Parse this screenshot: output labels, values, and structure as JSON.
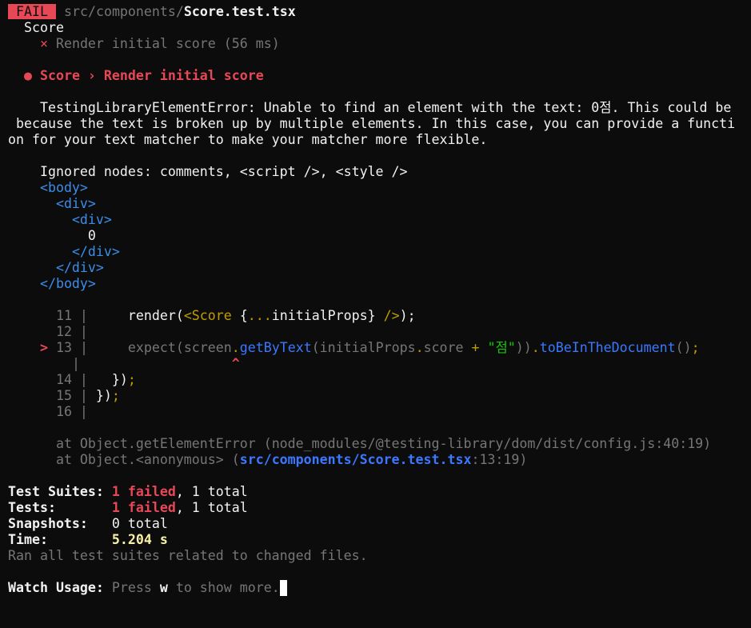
{
  "header": {
    "badge": "FAIL",
    "path_dir": "src/components/",
    "path_file": "Score.test.tsx"
  },
  "suite": {
    "name": "Score",
    "cross": "×",
    "test_name": "Render initial score (56 ms)"
  },
  "failure": {
    "bullet": "●",
    "title": "Score › Render initial score",
    "error_lines": [
      "TestingLibraryElementError: Unable to find an element with the text: 0점. This could be",
      " because the text is broken up by multiple elements. In this case, you can provide a functi",
      "on for your text matcher to make your matcher more flexible."
    ],
    "ignored": "Ignored nodes: comments, <script />, <style />",
    "dom": {
      "body_open": "<body>",
      "div_open": "<div>",
      "inner_div_open": "<div>",
      "text": "0",
      "inner_div_close": "</div>",
      "div_close": "</div>",
      "body_close": "</body>"
    }
  },
  "code": {
    "pointer": ">",
    "caret": "^",
    "lines": [
      {
        "num": "11",
        "code": "render(<Score {...initialProps} />);"
      },
      {
        "num": "12",
        "code": ""
      },
      {
        "num": "13",
        "code": "expect(screen.getByText(initialProps.score + \"점\")).toBeInTheDocument();"
      },
      {
        "num": "14",
        "code": "});"
      },
      {
        "num": "15",
        "code": "});"
      },
      {
        "num": "16",
        "code": ""
      }
    ]
  },
  "stack": {
    "line1_prefix": "at Object.getElementError ",
    "line1_loc": "(node_modules/@testing-library/dom/dist/config.js:40:19)",
    "line2_prefix": "at Object.<anonymous> (",
    "line2_link": "src/components/Score.test.tsx",
    "line2_suffix": ":13:19)"
  },
  "summary": {
    "suites_label": "Test Suites:",
    "suites_failed": "1 failed",
    "suites_total": ", 1 total",
    "tests_label": "Tests:",
    "tests_failed": "1 failed",
    "tests_total": ", 1 total",
    "snapshots_label": "Snapshots:",
    "snapshots_value": "0 total",
    "time_label": "Time:",
    "time_value": "5.204 s",
    "ran_all": "Ran all test suites related to changed files."
  },
  "watch": {
    "label": "Watch Usage:",
    "press": "Press ",
    "key": "w",
    "rest": " to show more."
  }
}
